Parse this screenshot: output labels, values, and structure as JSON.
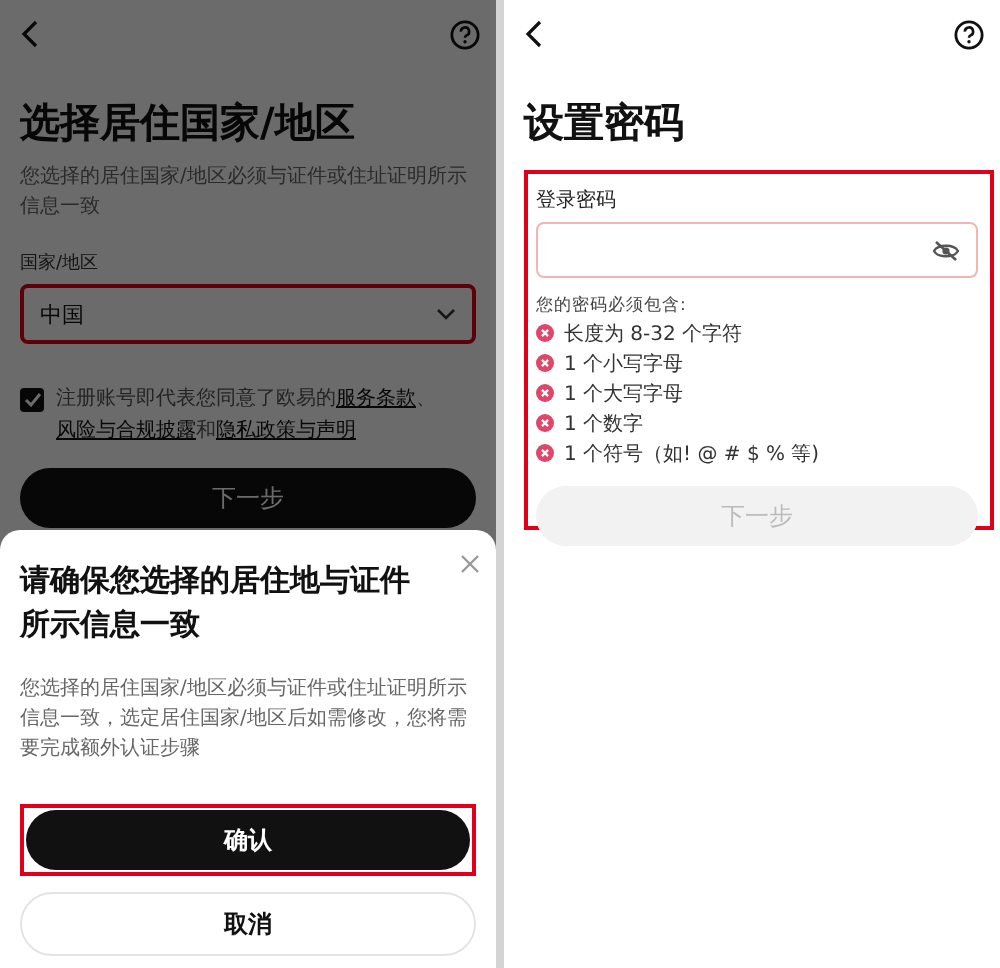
{
  "left_screen": {
    "title": "选择居住国家/地区",
    "subtitle": "您选择的居住国家/地区必须与证件或住址证明所示信息一致",
    "country_label": "国家/地区",
    "country_field": {
      "value": "中国",
      "highlighted": true
    },
    "agreement": {
      "checked": true,
      "parts": [
        {
          "kind": "text",
          "text": "注册账号即代表您同意了欧易的"
        },
        {
          "kind": "link",
          "text": "服务条款"
        },
        {
          "kind": "text",
          "text": "、"
        },
        {
          "kind": "link",
          "text": "风险与合规披露"
        },
        {
          "kind": "text",
          "text": "和"
        },
        {
          "kind": "link",
          "text": "隐私政策与声明"
        }
      ]
    },
    "next_button": "下一步",
    "dialog": {
      "title": "请确保您选择的居住地与证件所示信息一致",
      "body": "您选择的居住国家/地区必须与证件或住址证明所示信息一致，选定居住国家/地区后如需修改，您将需要完成额外认证步骤",
      "confirm_button": {
        "label": "确认",
        "highlighted": true
      },
      "cancel_button": "取消"
    }
  },
  "right_screen": {
    "title": "设置密码",
    "password_section": {
      "highlighted": true,
      "label": "登录密码",
      "requirements_title": "您的密码必须包含:",
      "requirements": [
        {
          "text": "长度为 8-32 个字符",
          "met": false
        },
        {
          "text": "1 个小写字母",
          "met": false
        },
        {
          "text": "1 个大写字母",
          "met": false
        },
        {
          "text": "1 个数字",
          "met": false
        },
        {
          "text": "1 个符号（如! @ # $ % 等)",
          "met": false
        }
      ],
      "next_button": {
        "label": "下一步",
        "disabled": true
      }
    }
  }
}
